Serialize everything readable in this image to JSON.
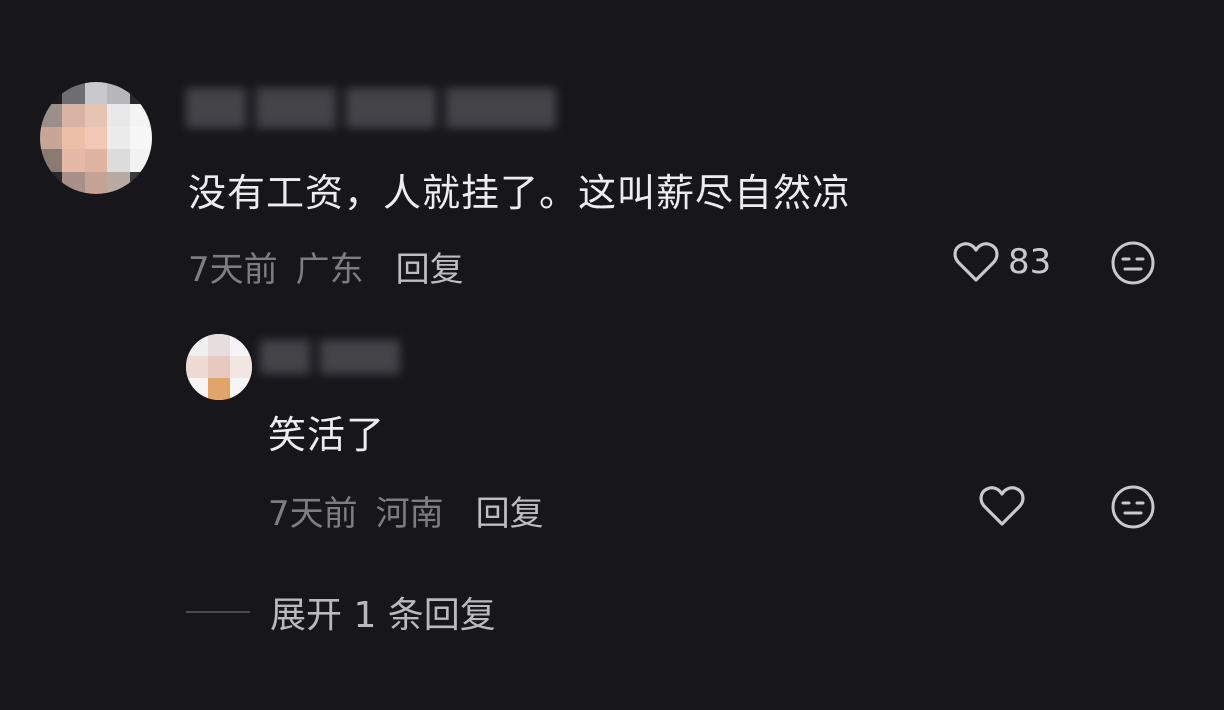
{
  "comment": {
    "text": "没有工资，人就挂了。这叫薪尽自然凉",
    "time": "7天前",
    "location": "广东",
    "reply_label": "回复",
    "likes": "83",
    "like_icon": "heart-outline-icon",
    "emoji_icon": "neutral-face-icon"
  },
  "reply": {
    "text": "笑活了",
    "time": "7天前",
    "location": "河南",
    "reply_label": "回复",
    "like_icon": "heart-outline-icon",
    "emoji_icon": "neutral-face-icon"
  },
  "expand": {
    "label": "展开 1 条回复"
  },
  "colors": {
    "background": "#17161b",
    "text_primary": "#ededef",
    "text_secondary": "#7d7d83"
  }
}
